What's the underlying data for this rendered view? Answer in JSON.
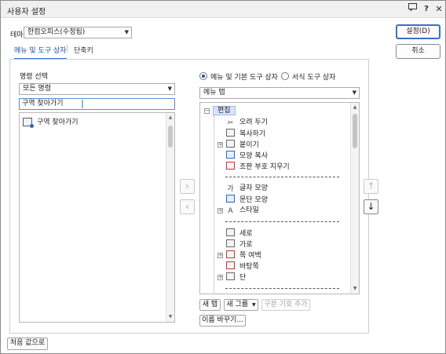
{
  "window": {
    "title": "사용자 설정",
    "feedback_icon": "feedback-icon",
    "help_label": "?",
    "close_label": "✕"
  },
  "theme": {
    "label": "테마",
    "value": "한컴오피스(수정됨)"
  },
  "tabs": [
    {
      "label": "메뉴 및 도구 상자",
      "active": true
    },
    {
      "label": "단축키",
      "active": false
    }
  ],
  "tab_separator": "|",
  "buttons": {
    "ok": "설정(D)",
    "cancel": "취소",
    "reset": "처음 값으로"
  },
  "command_select": {
    "label": "명령 선택",
    "combo_value": "모든 명령",
    "search_value": "구역 찾아가기",
    "results": [
      {
        "label": "구역 찾아가기",
        "icon": "goto-section-icon"
      }
    ]
  },
  "arrows": {
    "add": "›",
    "remove": "‹",
    "up": "↑",
    "down": "↓"
  },
  "target": {
    "radios": [
      {
        "label": "메뉴 및 기본 도구 상자",
        "selected": true
      },
      {
        "label": "서식 도구 상자",
        "selected": false
      }
    ],
    "combo_value": "메뉴 탭",
    "tree": {
      "group": "편집",
      "items": [
        {
          "label": "오려 두기",
          "icon": "scissors-icon",
          "expandable": false
        },
        {
          "label": "복사하기",
          "icon": "copy-icon",
          "expandable": false
        },
        {
          "label": "붙이기",
          "icon": "paste-icon",
          "expandable": true
        },
        {
          "label": "모양 복사",
          "icon": "format-painter-icon",
          "expandable": false
        },
        {
          "label": "조판 부호 지우기",
          "icon": "clear-marks-icon",
          "expandable": false
        },
        {
          "label": "글자 모양",
          "icon": "char-shape-icon",
          "expandable": false
        },
        {
          "label": "문단 모양",
          "icon": "para-shape-icon",
          "expandable": false
        },
        {
          "label": "스타일",
          "icon": "style-icon",
          "expandable": true
        },
        {
          "label": "세로",
          "icon": "portrait-icon",
          "expandable": false
        },
        {
          "label": "가로",
          "icon": "landscape-icon",
          "expandable": false
        },
        {
          "label": "쪽 여백",
          "icon": "margin-icon",
          "expandable": true
        },
        {
          "label": "바탕쪽",
          "icon": "master-page-icon",
          "expandable": false
        },
        {
          "label": "단",
          "icon": "columns-icon",
          "expandable": true
        }
      ]
    },
    "buttons": {
      "new_tab": "새 탭",
      "new_group": "새 그룹",
      "add_separator": "구분 기호 추가",
      "rename": "이름 바꾸기..."
    }
  },
  "colors": {
    "accent": "#2e6bd1",
    "tab_active_text": "#1b4fa8",
    "selection": "#d7e5fb"
  }
}
